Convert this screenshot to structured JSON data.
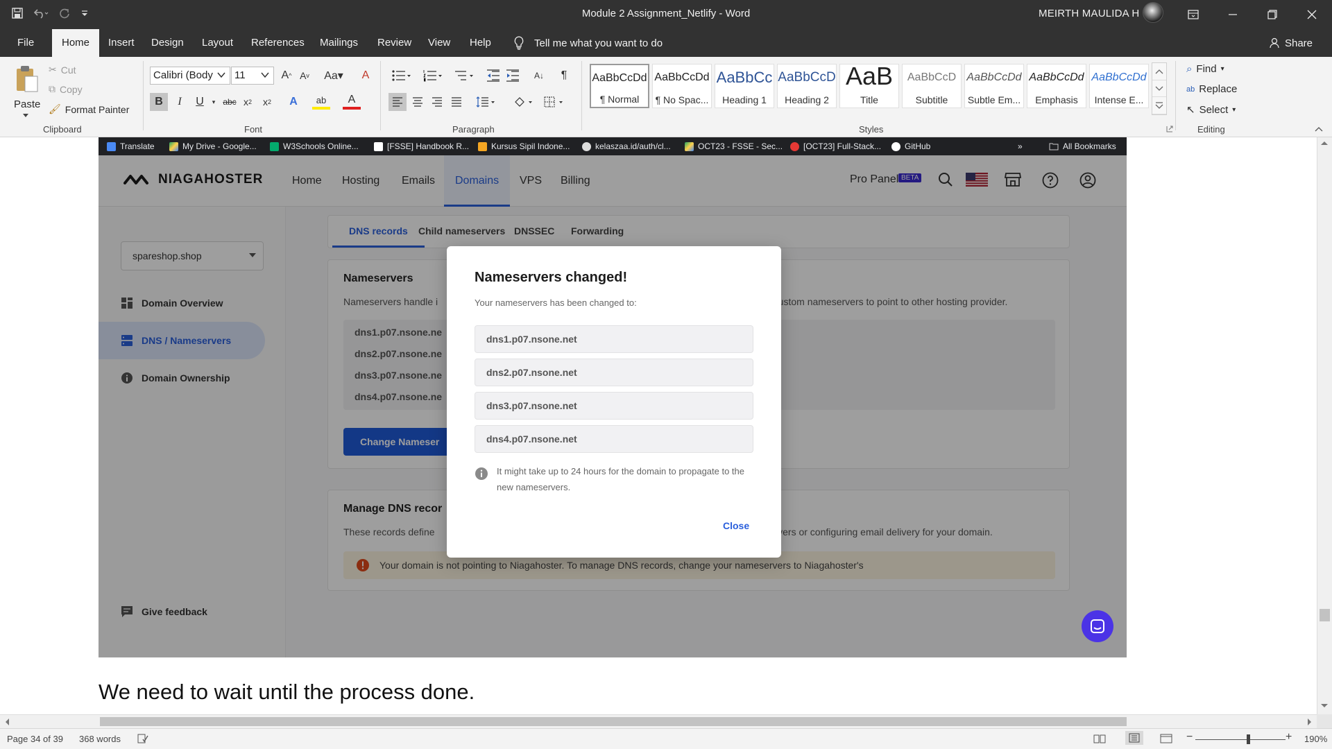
{
  "window": {
    "title": "Module 2 Assignment_Netlify  -  Word",
    "user": "MEIRTH MAULIDA H"
  },
  "ribbon_tabs": [
    "File",
    "Home",
    "Insert",
    "Design",
    "Layout",
    "References",
    "Mailings",
    "Review",
    "View",
    "Help"
  ],
  "tell_me": "Tell me what you want to do",
  "share": "Share",
  "clipboard": {
    "paste": "Paste",
    "cut": "Cut",
    "copy": "Copy",
    "format_painter": "Format Painter",
    "label": "Clipboard"
  },
  "font": {
    "name": "Calibri (Body",
    "size": "11",
    "label": "Font"
  },
  "paragraph": {
    "label": "Paragraph"
  },
  "styles": {
    "label": "Styles",
    "items": [
      {
        "preview": "AaBbCcDd",
        "name": "¶ Normal"
      },
      {
        "preview": "AaBbCcDd",
        "name": "¶ No Spac..."
      },
      {
        "preview": "AaBbCc",
        "name": "Heading 1"
      },
      {
        "preview": "AaBbCcD",
        "name": "Heading 2"
      },
      {
        "preview": "AaB",
        "name": "Title"
      },
      {
        "preview": "AaBbCcD",
        "name": "Subtitle"
      },
      {
        "preview": "AaBbCcDd",
        "name": "Subtle Em..."
      },
      {
        "preview": "AaBbCcDd",
        "name": "Emphasis"
      },
      {
        "preview": "AaBbCcDd",
        "name": "Intense E..."
      }
    ]
  },
  "editing": {
    "find": "Find",
    "replace": "Replace",
    "select": "Select",
    "label": "Editing"
  },
  "bookmarks": [
    "Translate",
    "My Drive - Google...",
    "W3Schools Online...",
    "[FSSE] Handbook R...",
    "Kursus Sipil Indone...",
    "kelaszaa.id/auth/cl...",
    "OCT23 - FSSE - Sec...",
    "[OCT23] Full-Stack...",
    "GitHub",
    "All Bookmarks"
  ],
  "site": {
    "logo": "NIAGAHOSTER",
    "nav": [
      "Home",
      "Hosting",
      "Emails",
      "Domains",
      "VPS",
      "Billing"
    ],
    "pro_panel": "Pro Panel",
    "beta": "BETA"
  },
  "sidebar": {
    "domain": "spareshop.shop",
    "items": [
      "Domain Overview",
      "DNS / Nameservers",
      "Domain Ownership"
    ],
    "feedback": "Give feedback"
  },
  "subtabs": [
    "DNS records",
    "Child nameservers",
    "DNSSEC",
    "Forwarding"
  ],
  "nameservers_card": {
    "title": "Nameservers",
    "desc_left": "Nameservers handle i",
    "desc_right": "e custom nameservers to point to other hosting provider.",
    "list": [
      "dns1.p07.nsone.ne",
      "dns2.p07.nsone.ne",
      "dns3.p07.nsone.ne",
      "dns4.p07.nsone.ne"
    ],
    "button": "Change Nameser"
  },
  "dns_card": {
    "title": "Manage DNS recor",
    "desc_left": "These records define",
    "desc_right": "b servers or configuring email delivery for your domain.",
    "warning": "Your domain is not pointing to Niagahoster. To manage DNS records, change your nameservers to Niagahoster's"
  },
  "modal": {
    "title": "Nameservers changed!",
    "subtitle": "Your nameservers has been changed to:",
    "nameservers": [
      "dns1.p07.nsone.net",
      "dns2.p07.nsone.net",
      "dns3.p07.nsone.net",
      "dns4.p07.nsone.net"
    ],
    "note": "It might take up to 24 hours for the domain to propagate to the new nameservers.",
    "close": "Close"
  },
  "document": {
    "text": "We need to wait until the process done."
  },
  "statusbar": {
    "page": "Page 34 of 39",
    "words": "368 words",
    "zoom": "190%"
  }
}
